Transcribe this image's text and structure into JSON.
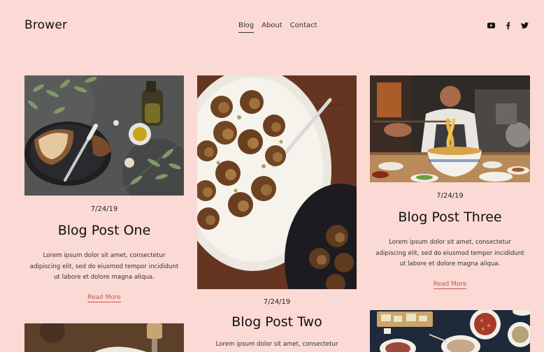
{
  "site": {
    "logo": "Brower"
  },
  "nav": {
    "items": [
      {
        "label": "Blog",
        "active": true
      },
      {
        "label": "About",
        "active": false
      },
      {
        "label": "Contact",
        "active": false
      }
    ]
  },
  "social": [
    "youtube-icon",
    "facebook-icon",
    "twitter-icon"
  ],
  "posts": [
    {
      "date": "7/24/19",
      "title": "Blog Post One",
      "excerpt": "Lorem ipsum dolor sit amet, consectetur adipiscing elit, sed do eiusmod tempor incididunt ut labore et dolore magna aliqua.",
      "read_more": "Read More"
    },
    {
      "date": "7/24/19",
      "title": "Blog Post Two",
      "excerpt": "Lorem ipsum dolor sit amet, consectetur"
    },
    {
      "date": "7/24/19",
      "title": "Blog Post Three",
      "excerpt": "Lorem ipsum dolor sit amet, consectetur adipiscing elit, sed do eiusmod tempor incididunt ut labore et dolore magna aliqua.",
      "read_more": "Read More"
    }
  ],
  "colors": {
    "background": "#fbd9d4",
    "link": "#c05a56",
    "text": "#111111"
  }
}
